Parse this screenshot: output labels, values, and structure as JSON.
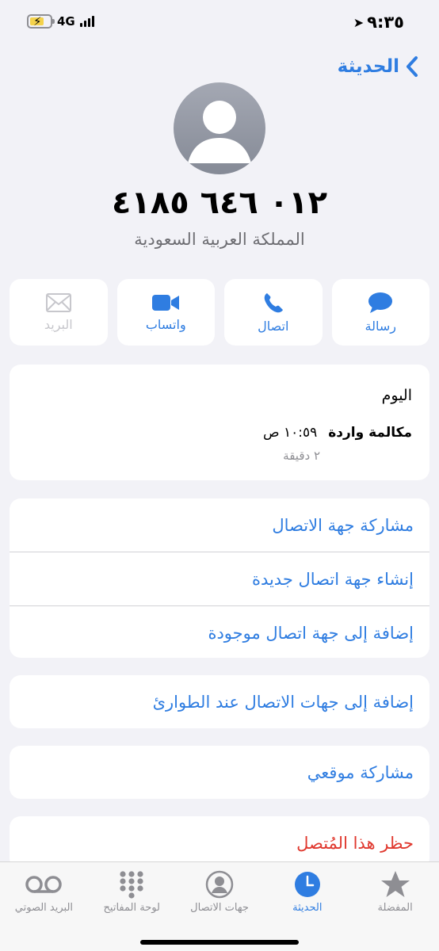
{
  "status": {
    "time": "٩:٣٥",
    "network": "4G"
  },
  "nav": {
    "back_label": "الحديثة"
  },
  "contact": {
    "phone": "٠١٢ ٦٤٦ ٤١٨٥",
    "country": "المملكة العربية السعودية"
  },
  "actions": [
    {
      "label": "رسالة",
      "icon": "message-icon",
      "enabled": true
    },
    {
      "label": "اتصال",
      "icon": "phone-icon",
      "enabled": true
    },
    {
      "label": "واتساب",
      "icon": "video-icon",
      "enabled": true
    },
    {
      "label": "البريد",
      "icon": "mail-icon",
      "enabled": false
    }
  ],
  "recent": {
    "day": "اليوم",
    "time": "١٠:٥٩ ص",
    "type": "مكالمة واردة",
    "duration": "٢ دقيقة"
  },
  "menu": {
    "share_contact": "مشاركة جهة الاتصال",
    "create_contact": "إنشاء جهة اتصال جديدة",
    "add_existing": "إضافة إلى جهة اتصال موجودة",
    "add_emergency": "إضافة إلى جهات الاتصال عند الطوارئ",
    "share_location": "مشاركة موقعي",
    "block_caller": "حظر هذا المُتصل"
  },
  "tabs": [
    {
      "label": "المفضلة",
      "icon": "star-icon",
      "active": false
    },
    {
      "label": "الحديثة",
      "icon": "clock-icon",
      "active": true
    },
    {
      "label": "جهات الاتصال",
      "icon": "person-icon",
      "active": false
    },
    {
      "label": "لوحة المفاتيح",
      "icon": "keypad-icon",
      "active": false
    },
    {
      "label": "البريد الصوتي",
      "icon": "voicemail-icon",
      "active": false
    }
  ],
  "colors": {
    "accent": "#2f7de1",
    "danger": "#e0382e",
    "background": "#f2f2f7"
  }
}
